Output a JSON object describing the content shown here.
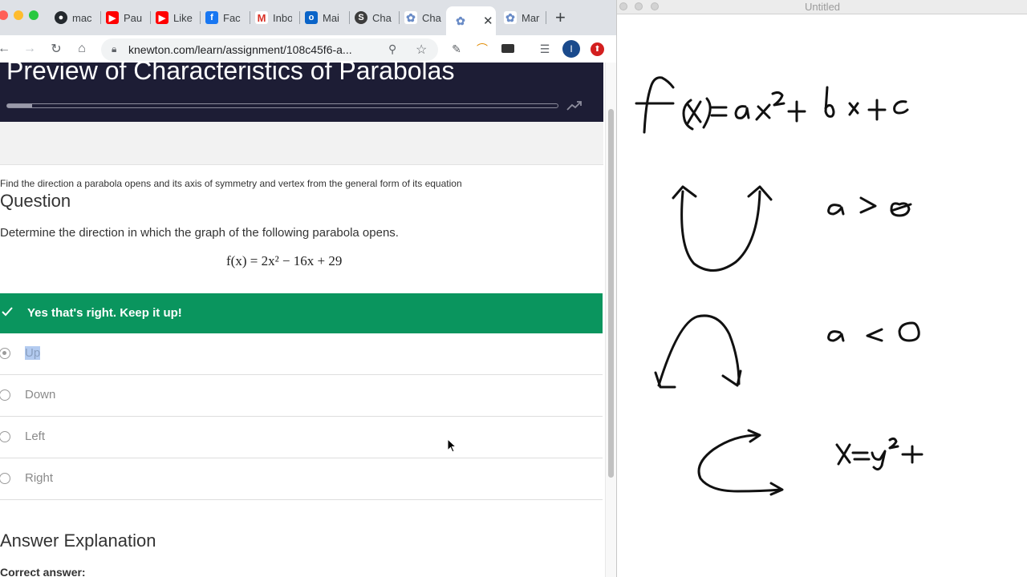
{
  "browser": {
    "tabs": [
      {
        "label": "mac",
        "icon": "github-icon",
        "color": "#24292e"
      },
      {
        "label": "Pau",
        "icon": "youtube-icon",
        "color": "#ff0000"
      },
      {
        "label": "Like",
        "icon": "youtube-icon",
        "color": "#ff0000"
      },
      {
        "label": "Fac",
        "icon": "facebook-icon",
        "color": "#1877f2"
      },
      {
        "label": "Inbo",
        "icon": "gmail-icon",
        "color": "#d93025"
      },
      {
        "label": "Mai",
        "icon": "outlook-icon",
        "color": "#0a64c8"
      },
      {
        "label": "Cha",
        "icon": "skype-icon",
        "color": "#3c3c3c"
      },
      {
        "label": "Cha",
        "icon": "knewton-icon",
        "color": "#6a8cc7"
      },
      {
        "label": "",
        "icon": "knewton-icon",
        "color": "#6a8cc7",
        "active": true
      },
      {
        "label": "Mar",
        "icon": "knewton-icon",
        "color": "#6a8cc7"
      }
    ],
    "url": "knewton.com/learn/assignment/108c45f6-a...",
    "profile_initial": "I"
  },
  "page": {
    "title": "Preview of Characteristics of Parabolas",
    "progress_fraction": 0.045,
    "objective": "Find the direction a parabola opens and its axis of symmetry and vertex from the general form of its equation",
    "question_heading": "Question",
    "question_text": "Determine the direction in which the graph of the following parabola opens.",
    "equation": "f(x) = 2x² − 16x + 29",
    "feedback": "Yes that's right. Keep it up!",
    "choices": [
      {
        "label": "Up",
        "selected": true
      },
      {
        "label": "Down",
        "selected": false
      },
      {
        "label": "Left",
        "selected": false
      },
      {
        "label": "Right",
        "selected": false
      }
    ],
    "explanation_heading": "Answer Explanation",
    "correct_answer_label": "Correct answer:"
  },
  "notes": {
    "title": "Untitled"
  },
  "colors": {
    "banner": "#1d1d35",
    "success": "#0a955e",
    "tabstrip": "#dee1e6"
  }
}
